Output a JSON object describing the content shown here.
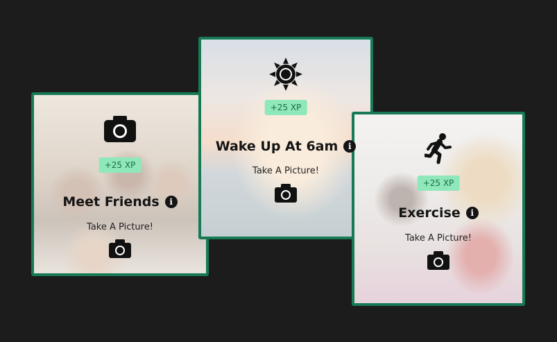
{
  "cards": [
    {
      "title": "Meet Friends",
      "xp": "+25 XP",
      "subtitle": "Take A Picture!",
      "icon": "camera-icon"
    },
    {
      "title": "Wake Up At 6am",
      "xp": "+25 XP",
      "subtitle": "Take A Picture!",
      "icon": "sun-icon"
    },
    {
      "title": "Exercise",
      "xp": "+25 XP",
      "subtitle": "Take A Picture!",
      "icon": "running-person-icon"
    }
  ],
  "colors": {
    "background": "#1c1c1c",
    "card_border": "#177a55",
    "xp_badge_bg": "#8ee8b9",
    "xp_badge_text": "#1d6b47"
  }
}
